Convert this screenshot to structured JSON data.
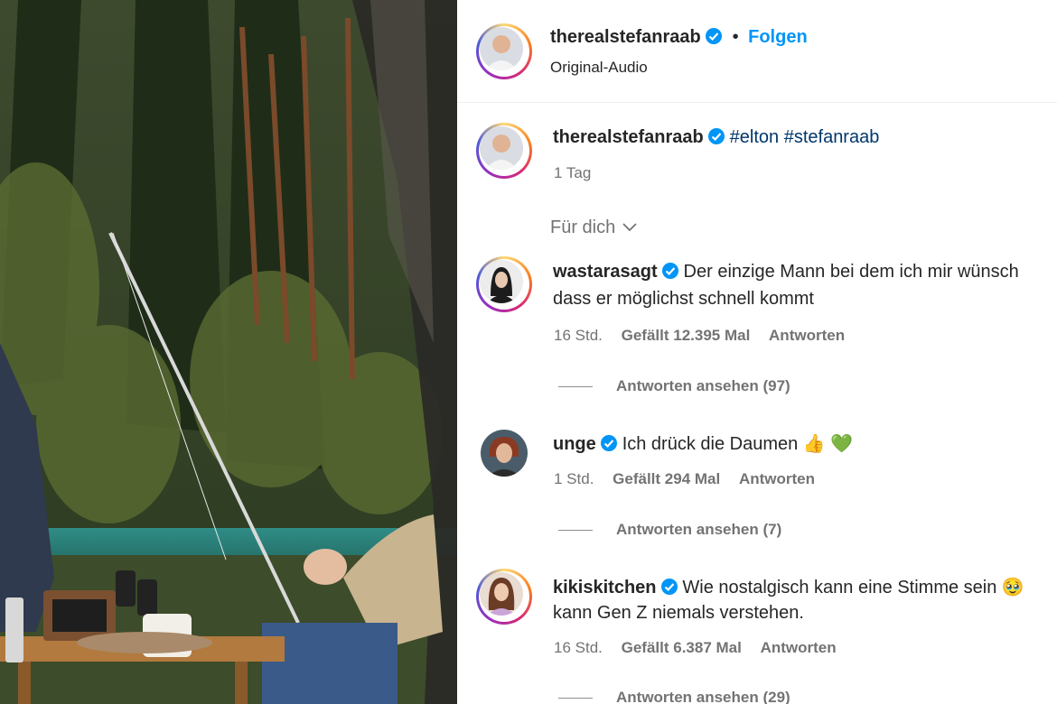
{
  "post": {
    "username": "therealstefanraab",
    "separator": "•",
    "follow_label": "Folgen",
    "audio": "Original-Audio"
  },
  "caption": {
    "username": "therealstefanraab",
    "text": "#elton #stefanraab",
    "time": "1 Tag"
  },
  "sort": {
    "label": "Für dich"
  },
  "comments": [
    {
      "username": "wastarasagt",
      "line1": "Der einzige Mann bei dem ich mir wünsch",
      "line2": "dass er möglichst schnell kommt",
      "time": "16 Std.",
      "likes": "Gefällt 12.395 Mal",
      "reply": "Antworten",
      "view_replies": "Antworten ansehen (97)"
    },
    {
      "username": "unge",
      "line1": "Ich drück die Daumen 👍 💚",
      "line2": "",
      "time": "1 Std.",
      "likes": "Gefällt 294 Mal",
      "reply": "Antworten",
      "view_replies": "Antworten ansehen (7)"
    },
    {
      "username": "kikiskitchen",
      "line1": "Wie nostalgisch kann eine Stimme sein 🥹",
      "line2": "kann Gen Z niemals verstehen.",
      "time": "16 Std.",
      "likes": "Gefällt 6.387 Mal",
      "reply": "Antworten",
      "view_replies": "Antworten ansehen (29)"
    }
  ],
  "colors": {
    "link": "#0095f6",
    "hashtag": "#00376b",
    "verified": "#0095f6",
    "muted": "#737373"
  }
}
